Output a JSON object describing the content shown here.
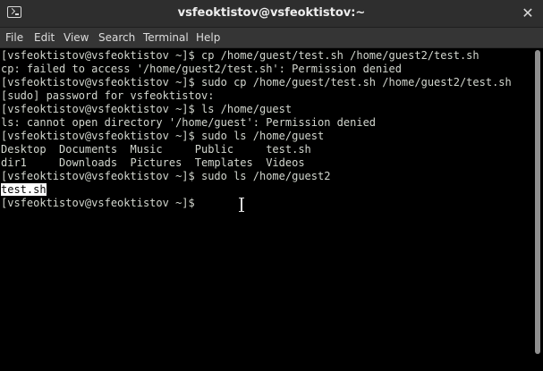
{
  "window": {
    "title": "vsfeoktistov@vsfeoktistov:~"
  },
  "menu": {
    "items": [
      "File",
      "Edit",
      "View",
      "Search",
      "Terminal",
      "Help"
    ]
  },
  "terminal": {
    "lines": [
      "[vsfeoktistov@vsfeoktistov ~]$ cp /home/guest/test.sh /home/guest2/test.sh",
      "cp: failed to access '/home/guest2/test.sh': Permission denied",
      "[vsfeoktistov@vsfeoktistov ~]$ sudo cp /home/guest/test.sh /home/guest2/test.sh",
      "[sudo] password for vsfeoktistov:",
      "[vsfeoktistov@vsfeoktistov ~]$ ls /home/guest",
      "ls: cannot open directory '/home/guest': Permission denied",
      "[vsfeoktistov@vsfeoktistov ~]$ sudo ls /home/guest",
      "Desktop  Documents  Music     Public     test.sh",
      "dir1     Downloads  Pictures  Templates  Videos",
      "[vsfeoktistov@vsfeoktistov ~]$ sudo ls /home/guest2",
      "test.sh",
      "[vsfeoktistov@vsfeoktistov ~]$ "
    ],
    "selected_line_index": 10,
    "text_color": "#d3d7cf",
    "background_color": "#000000"
  },
  "icons": {
    "title_icon": "terminal-icon",
    "close_icon": "close-icon",
    "cursor_icon": "ibeam-cursor-icon"
  }
}
